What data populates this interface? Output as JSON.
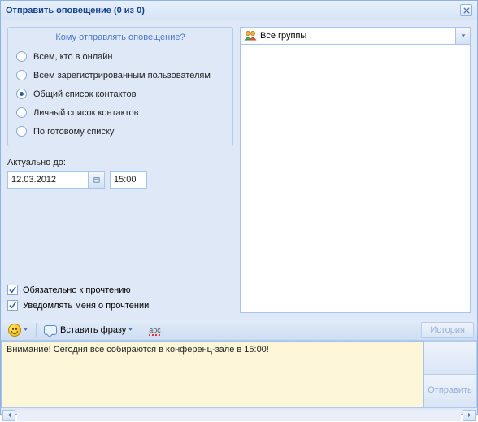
{
  "title": "Отправить оповещение (0 из 0)",
  "group": {
    "title": "Кому отправлять оповещение?",
    "options": [
      {
        "label": "Всем, кто в онлайн",
        "checked": false
      },
      {
        "label": "Всем зарегистрированным пользователям",
        "checked": false
      },
      {
        "label": "Общий список контактов",
        "checked": true
      },
      {
        "label": "Личный список контактов",
        "checked": false
      },
      {
        "label": "По готовому списку",
        "checked": false
      }
    ]
  },
  "actual_label": "Актуально до:",
  "date_value": "12.03.2012",
  "time_value": "15:00",
  "checks": [
    {
      "label": "Обязательно к прочтению",
      "checked": true
    },
    {
      "label": "Уведомлять меня о прочтении",
      "checked": true
    }
  ],
  "combo": {
    "label": "Все группы"
  },
  "toolbar": {
    "insert_phrase": "Вставить фразу",
    "spell_text": "abc",
    "history": "История"
  },
  "message": "Внимание! Сегодня все собираются в конференц-зале в 15:00!",
  "send_btn": "Отправить"
}
